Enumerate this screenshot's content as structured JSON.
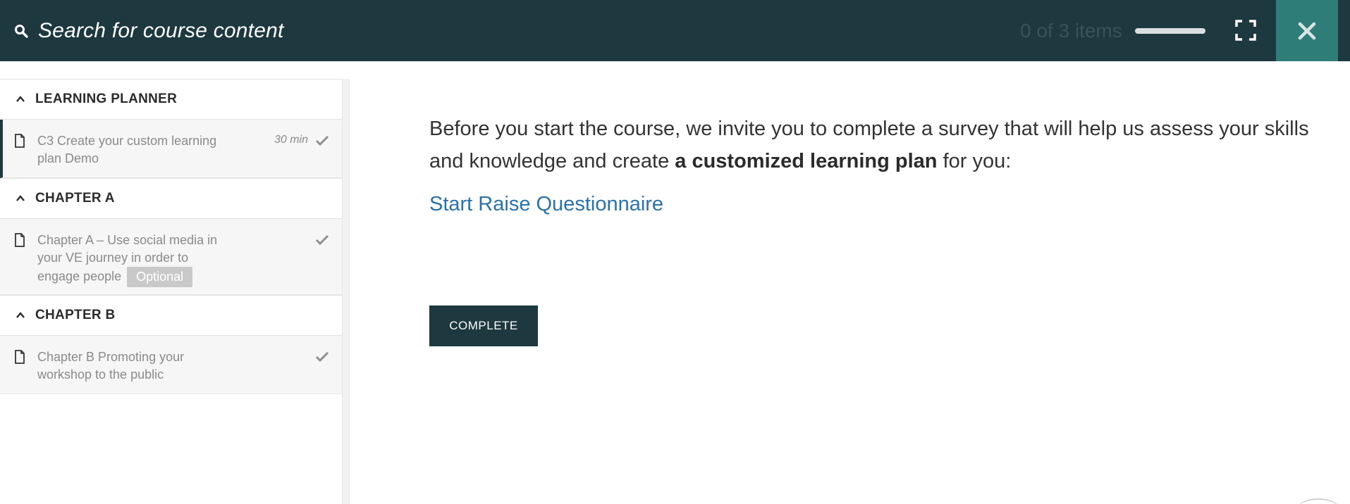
{
  "header": {
    "search_placeholder": "Search for course content",
    "progress_text": "0 of 3 items",
    "progress_fraction": 0,
    "icons": {
      "search": "search-icon",
      "expand": "expand-icon",
      "close": "close-icon"
    },
    "colors": {
      "bar": "#1e3840",
      "close_bg": "#2f7d79"
    }
  },
  "sidebar": {
    "sections": [
      {
        "title": "LEARNING PLANNER",
        "units": [
          {
            "title": "C3 Create your custom learning plan Demo",
            "duration": "30 min"
          }
        ]
      },
      {
        "title": "CHAPTER A",
        "units": [
          {
            "title": "Chapter A – Use social media in your VE journey in order to engage people",
            "badge": "Optional"
          }
        ]
      },
      {
        "title": "CHAPTER B",
        "units": [
          {
            "title": "Chapter B Promoting your workshop to the public"
          }
        ]
      }
    ]
  },
  "main": {
    "intro_before": "Before you start the course, we invite you to complete a survey that will help us assess your skills and knowledge and create ",
    "intro_bold": "a customized learning plan",
    "intro_after": " for you:",
    "link_label": "Start Raise Questionnaire",
    "complete_label": "COMPLETE",
    "colors": {
      "link": "#2a72ad",
      "button": "#1e3840"
    }
  }
}
